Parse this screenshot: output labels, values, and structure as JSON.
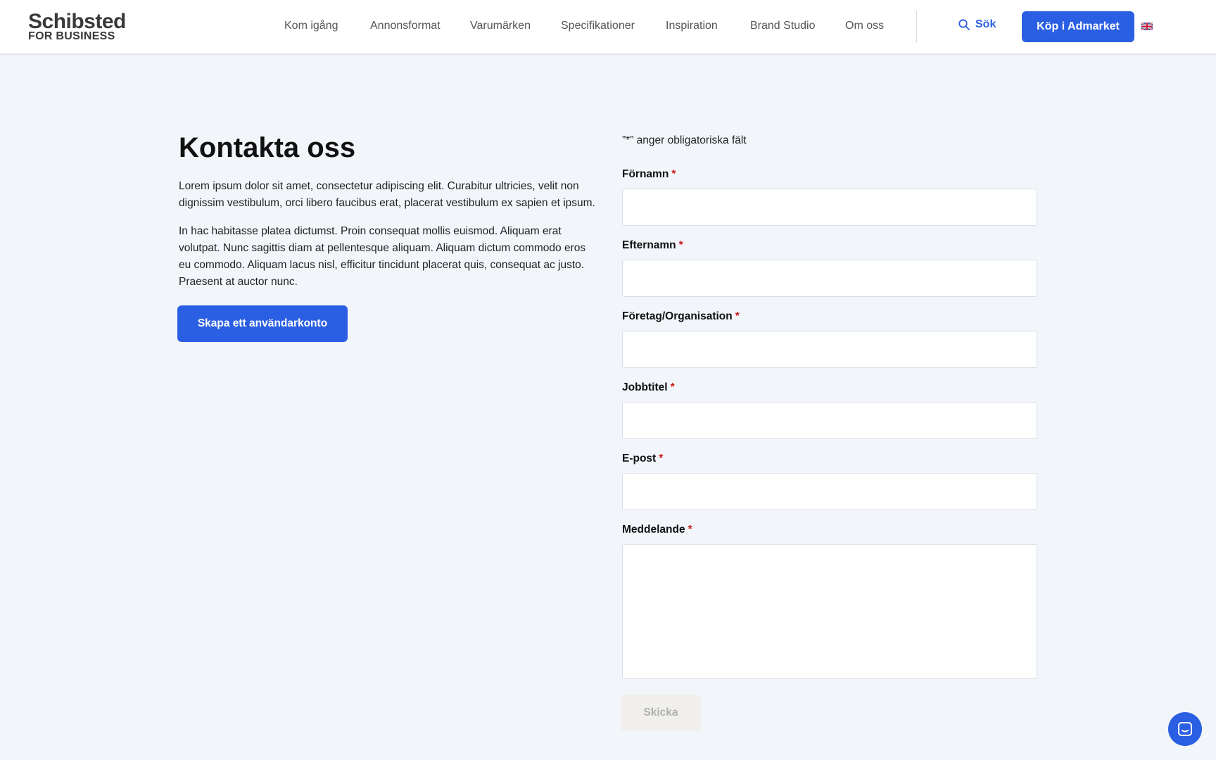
{
  "header": {
    "logo_top": "Schibsted",
    "logo_bottom": "FOR BUSINESS",
    "nav": [
      {
        "label": "Kom igång"
      },
      {
        "label": "Annonsformat"
      },
      {
        "label": "Varumärken"
      },
      {
        "label": "Specifikationer"
      },
      {
        "label": "Inspiration"
      },
      {
        "label": "Brand Studio"
      },
      {
        "label": "Om oss"
      }
    ],
    "search_label": "Sök",
    "buy_label": "Köp i Admarket",
    "language_icon": "uk-flag-icon"
  },
  "intro": {
    "title": "Kontakta oss",
    "paragraph1": "Lorem ipsum dolor sit amet, consectetur adipiscing elit. Curabitur ultricies, velit non dignissim vestibulum, orci libero faucibus erat, placerat vestibulum ex sapien et ipsum.",
    "paragraph2": "In hac habitasse platea dictumst. Proin consequat mollis euismod. Aliquam erat volutpat. Nunc sagittis diam at pellentesque aliquam. Aliquam dictum commodo eros eu commodo. Aliquam lacus nisl, efficitur tincidunt placerat quis, consequat ac justo. Praesent at auctor nunc.",
    "create_account_label": "Skapa ett användarkonto"
  },
  "form": {
    "required_note": "”*” anger obligatoriska fält",
    "required_mark": "*",
    "fields": [
      {
        "label": "Förnamn",
        "value": ""
      },
      {
        "label": "Efternamn",
        "value": ""
      },
      {
        "label": "Företag/Organisation",
        "value": ""
      },
      {
        "label": "Jobbtitel",
        "value": ""
      },
      {
        "label": "E-post",
        "value": ""
      },
      {
        "label": "Meddelande",
        "value": ""
      }
    ],
    "submit_label": "Skicka"
  },
  "colors": {
    "accent": "#2b5fe3",
    "background": "#f2f5f9",
    "required": "#cc1f1f"
  }
}
